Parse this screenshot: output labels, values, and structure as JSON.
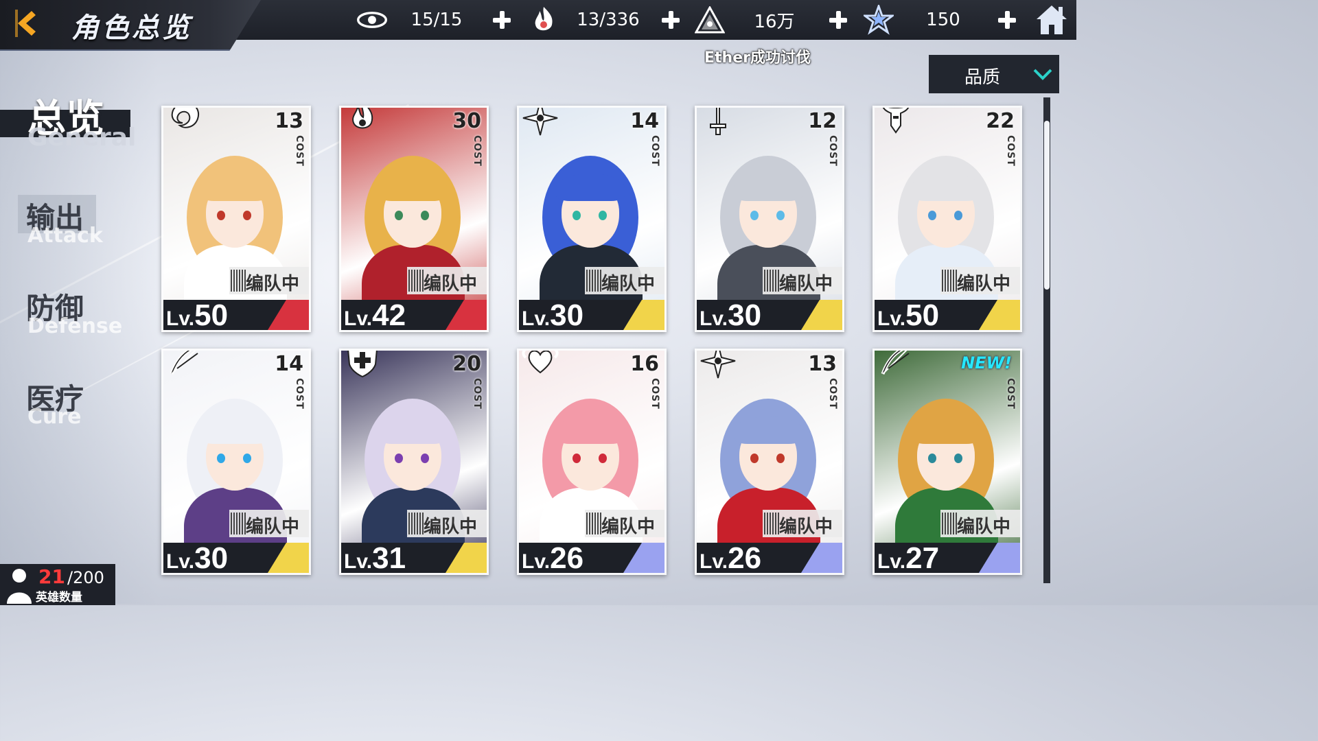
{
  "header": {
    "title": "角色总览",
    "back_icon": "back-arrow-icon",
    "home_icon": "home-icon"
  },
  "resources": [
    {
      "icon": "eye-icon",
      "value": "15/15"
    },
    {
      "icon": "flame-hand-icon",
      "value": "13/336"
    },
    {
      "icon": "triangle-emblem-icon",
      "value": "16万"
    },
    {
      "icon": "star-crystal-icon",
      "value": "150"
    }
  ],
  "ticker": "Ether成功讨伐",
  "sort": {
    "label": "品质",
    "icon": "chevron-down-icon"
  },
  "tabs": [
    {
      "zh": "总览",
      "en": "General",
      "active": true
    },
    {
      "zh": "输出",
      "en": "Attack",
      "active": false
    },
    {
      "zh": "防御",
      "en": "Defense",
      "active": false
    },
    {
      "zh": "医疗",
      "en": "Cure",
      "active": false
    }
  ],
  "cost_label": "COST",
  "lv_prefix": "Lv.",
  "team_label": "编队中",
  "new_label": "NEW!",
  "cards": [
    {
      "class_icon": "dragon-icon",
      "cost": "13",
      "level": "50",
      "stripe": "#d8323f",
      "hair": "#f1c27a",
      "outfit": "#ffffff",
      "eye": "#c0392b",
      "bg": "#e9e6e4"
    },
    {
      "class_icon": "flame-icon",
      "cost": "30",
      "level": "42",
      "stripe": "#d8323f",
      "hair": "#e8b24a",
      "outfit": "#b0212c",
      "eye": "#3c8a5a",
      "bg": "#c43a3a"
    },
    {
      "class_icon": "shuriken-icon",
      "cost": "14",
      "level": "30",
      "stripe": "#f1d44a",
      "hair": "#3a5fd6",
      "outfit": "#222a36",
      "eye": "#2fb6a2",
      "bg": "#dfe8f2"
    },
    {
      "class_icon": "sword-icon",
      "cost": "12",
      "level": "30",
      "stripe": "#f1d44a",
      "hair": "#c9cdd6",
      "outfit": "#4a4f5a",
      "eye": "#5dbbe8",
      "bg": "#d7dce4"
    },
    {
      "class_icon": "horned-helm-icon",
      "cost": "22",
      "level": "50",
      "stripe": "#f1d44a",
      "hair": "#e3e3e6",
      "outfit": "#e6eef8",
      "eye": "#4a9ad8",
      "bg": "#ece8ea"
    },
    {
      "class_icon": "bow-icon",
      "cost": "14",
      "level": "30",
      "stripe": "#f1d44a",
      "hair": "#eef0f6",
      "outfit": "#5d3f87",
      "eye": "#2fa8e8",
      "bg": "#f2f3f7"
    },
    {
      "class_icon": "shield-cross-icon",
      "cost": "20",
      "level": "31",
      "stripe": "#f1d44a",
      "hair": "#dcd4ec",
      "outfit": "#2c3a5c",
      "eye": "#7b3fb0",
      "bg": "#39355a"
    },
    {
      "class_icon": "winged-heart-icon",
      "cost": "16",
      "level": "26",
      "stripe": "#9aa2f0",
      "hair": "#f39aa8",
      "outfit": "#ffffff",
      "eye": "#d02a3a",
      "bg": "#f6e9ea"
    },
    {
      "class_icon": "shuriken-icon",
      "cost": "13",
      "level": "26",
      "stripe": "#9aa2f0",
      "hair": "#8fa2da",
      "outfit": "#c8202b",
      "eye": "#c0392b",
      "bg": "#eceaea"
    },
    {
      "class_icon": "bow-icon",
      "cost": "",
      "level": "27",
      "stripe": "#9aa2f0",
      "hair": "#e0a444",
      "outfit": "#2f7a3a",
      "eye": "#2a8a9a",
      "bg": "#3f6b3a",
      "new": true
    }
  ],
  "hero_count": {
    "current": "21",
    "max": "/200",
    "label": "英雄数量",
    "icon": "person-silhouette-icon"
  },
  "colors": {
    "accent_orange": "#f5a623",
    "bar_dark": "#1d2027",
    "count_red": "#ff3b3b",
    "new_cyan": "#26e8ff"
  }
}
